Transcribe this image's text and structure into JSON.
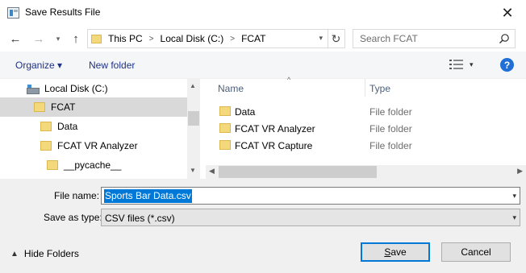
{
  "window": {
    "title": "Save Results File",
    "close_glyph": "✕"
  },
  "nav": {
    "back_glyph": "←",
    "forward_glyph": "→",
    "history_glyph": "▾",
    "up_glyph": "↑",
    "breadcrumbs": [
      "This PC",
      "Local Disk (C:)",
      "FCAT"
    ],
    "dropdown_glyph": "▾",
    "refresh_glyph": "↻",
    "search_placeholder": "Search FCAT"
  },
  "toolbar": {
    "organize_label": "Organize ▾",
    "new_folder_label": "New folder",
    "view_dropdown_glyph": "▾",
    "help_label": "?",
    "accent_color": "#1f6fd6"
  },
  "tree": {
    "items": [
      {
        "label": "Local Disk (C:)",
        "icon": "drive-icon"
      },
      {
        "label": "FCAT",
        "icon": "folder-icon",
        "selected": true
      },
      {
        "label": "Data",
        "icon": "folder-icon"
      },
      {
        "label": "FCAT VR Analyzer",
        "icon": "folder-icon"
      },
      {
        "label": "__pycache__",
        "icon": "folder-icon"
      }
    ]
  },
  "files": {
    "columns": {
      "name": "Name",
      "type": "Type"
    },
    "sort_glyph": "^",
    "rows": [
      {
        "name": "Data",
        "type": "File folder"
      },
      {
        "name": "FCAT VR Analyzer",
        "type": "File folder"
      },
      {
        "name": "FCAT VR Capture",
        "type": "File folder"
      }
    ]
  },
  "form": {
    "filename_label": "File name:",
    "filename_value": "Sports Bar Data.csv",
    "savetype_label": "Save as type:",
    "savetype_value": "CSV files (*.csv)",
    "hide_folders_label": "Hide Folders",
    "save_label": "Save",
    "cancel_label": "Cancel",
    "selection_color": "#0078d7"
  }
}
